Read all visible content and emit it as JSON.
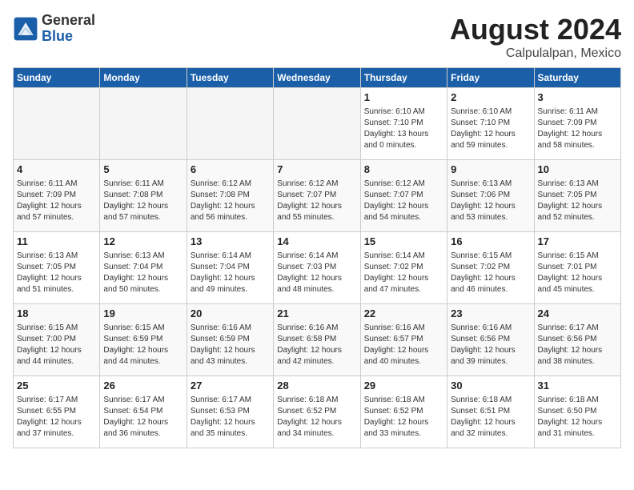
{
  "header": {
    "logo_general": "General",
    "logo_blue": "Blue",
    "month_year": "August 2024",
    "location": "Calpulalpan, Mexico"
  },
  "weekdays": [
    "Sunday",
    "Monday",
    "Tuesday",
    "Wednesday",
    "Thursday",
    "Friday",
    "Saturday"
  ],
  "weeks": [
    [
      {
        "day": "",
        "info": "",
        "empty": true
      },
      {
        "day": "",
        "info": "",
        "empty": true
      },
      {
        "day": "",
        "info": "",
        "empty": true
      },
      {
        "day": "",
        "info": "",
        "empty": true
      },
      {
        "day": "1",
        "info": "Sunrise: 6:10 AM\nSunset: 7:10 PM\nDaylight: 13 hours\nand 0 minutes."
      },
      {
        "day": "2",
        "info": "Sunrise: 6:10 AM\nSunset: 7:10 PM\nDaylight: 12 hours\nand 59 minutes."
      },
      {
        "day": "3",
        "info": "Sunrise: 6:11 AM\nSunset: 7:09 PM\nDaylight: 12 hours\nand 58 minutes."
      }
    ],
    [
      {
        "day": "4",
        "info": "Sunrise: 6:11 AM\nSunset: 7:09 PM\nDaylight: 12 hours\nand 57 minutes."
      },
      {
        "day": "5",
        "info": "Sunrise: 6:11 AM\nSunset: 7:08 PM\nDaylight: 12 hours\nand 57 minutes."
      },
      {
        "day": "6",
        "info": "Sunrise: 6:12 AM\nSunset: 7:08 PM\nDaylight: 12 hours\nand 56 minutes."
      },
      {
        "day": "7",
        "info": "Sunrise: 6:12 AM\nSunset: 7:07 PM\nDaylight: 12 hours\nand 55 minutes."
      },
      {
        "day": "8",
        "info": "Sunrise: 6:12 AM\nSunset: 7:07 PM\nDaylight: 12 hours\nand 54 minutes."
      },
      {
        "day": "9",
        "info": "Sunrise: 6:13 AM\nSunset: 7:06 PM\nDaylight: 12 hours\nand 53 minutes."
      },
      {
        "day": "10",
        "info": "Sunrise: 6:13 AM\nSunset: 7:05 PM\nDaylight: 12 hours\nand 52 minutes."
      }
    ],
    [
      {
        "day": "11",
        "info": "Sunrise: 6:13 AM\nSunset: 7:05 PM\nDaylight: 12 hours\nand 51 minutes."
      },
      {
        "day": "12",
        "info": "Sunrise: 6:13 AM\nSunset: 7:04 PM\nDaylight: 12 hours\nand 50 minutes."
      },
      {
        "day": "13",
        "info": "Sunrise: 6:14 AM\nSunset: 7:04 PM\nDaylight: 12 hours\nand 49 minutes."
      },
      {
        "day": "14",
        "info": "Sunrise: 6:14 AM\nSunset: 7:03 PM\nDaylight: 12 hours\nand 48 minutes."
      },
      {
        "day": "15",
        "info": "Sunrise: 6:14 AM\nSunset: 7:02 PM\nDaylight: 12 hours\nand 47 minutes."
      },
      {
        "day": "16",
        "info": "Sunrise: 6:15 AM\nSunset: 7:02 PM\nDaylight: 12 hours\nand 46 minutes."
      },
      {
        "day": "17",
        "info": "Sunrise: 6:15 AM\nSunset: 7:01 PM\nDaylight: 12 hours\nand 45 minutes."
      }
    ],
    [
      {
        "day": "18",
        "info": "Sunrise: 6:15 AM\nSunset: 7:00 PM\nDaylight: 12 hours\nand 44 minutes."
      },
      {
        "day": "19",
        "info": "Sunrise: 6:15 AM\nSunset: 6:59 PM\nDaylight: 12 hours\nand 44 minutes."
      },
      {
        "day": "20",
        "info": "Sunrise: 6:16 AM\nSunset: 6:59 PM\nDaylight: 12 hours\nand 43 minutes."
      },
      {
        "day": "21",
        "info": "Sunrise: 6:16 AM\nSunset: 6:58 PM\nDaylight: 12 hours\nand 42 minutes."
      },
      {
        "day": "22",
        "info": "Sunrise: 6:16 AM\nSunset: 6:57 PM\nDaylight: 12 hours\nand 40 minutes."
      },
      {
        "day": "23",
        "info": "Sunrise: 6:16 AM\nSunset: 6:56 PM\nDaylight: 12 hours\nand 39 minutes."
      },
      {
        "day": "24",
        "info": "Sunrise: 6:17 AM\nSunset: 6:56 PM\nDaylight: 12 hours\nand 38 minutes."
      }
    ],
    [
      {
        "day": "25",
        "info": "Sunrise: 6:17 AM\nSunset: 6:55 PM\nDaylight: 12 hours\nand 37 minutes."
      },
      {
        "day": "26",
        "info": "Sunrise: 6:17 AM\nSunset: 6:54 PM\nDaylight: 12 hours\nand 36 minutes."
      },
      {
        "day": "27",
        "info": "Sunrise: 6:17 AM\nSunset: 6:53 PM\nDaylight: 12 hours\nand 35 minutes."
      },
      {
        "day": "28",
        "info": "Sunrise: 6:18 AM\nSunset: 6:52 PM\nDaylight: 12 hours\nand 34 minutes."
      },
      {
        "day": "29",
        "info": "Sunrise: 6:18 AM\nSunset: 6:52 PM\nDaylight: 12 hours\nand 33 minutes."
      },
      {
        "day": "30",
        "info": "Sunrise: 6:18 AM\nSunset: 6:51 PM\nDaylight: 12 hours\nand 32 minutes."
      },
      {
        "day": "31",
        "info": "Sunrise: 6:18 AM\nSunset: 6:50 PM\nDaylight: 12 hours\nand 31 minutes."
      }
    ]
  ]
}
